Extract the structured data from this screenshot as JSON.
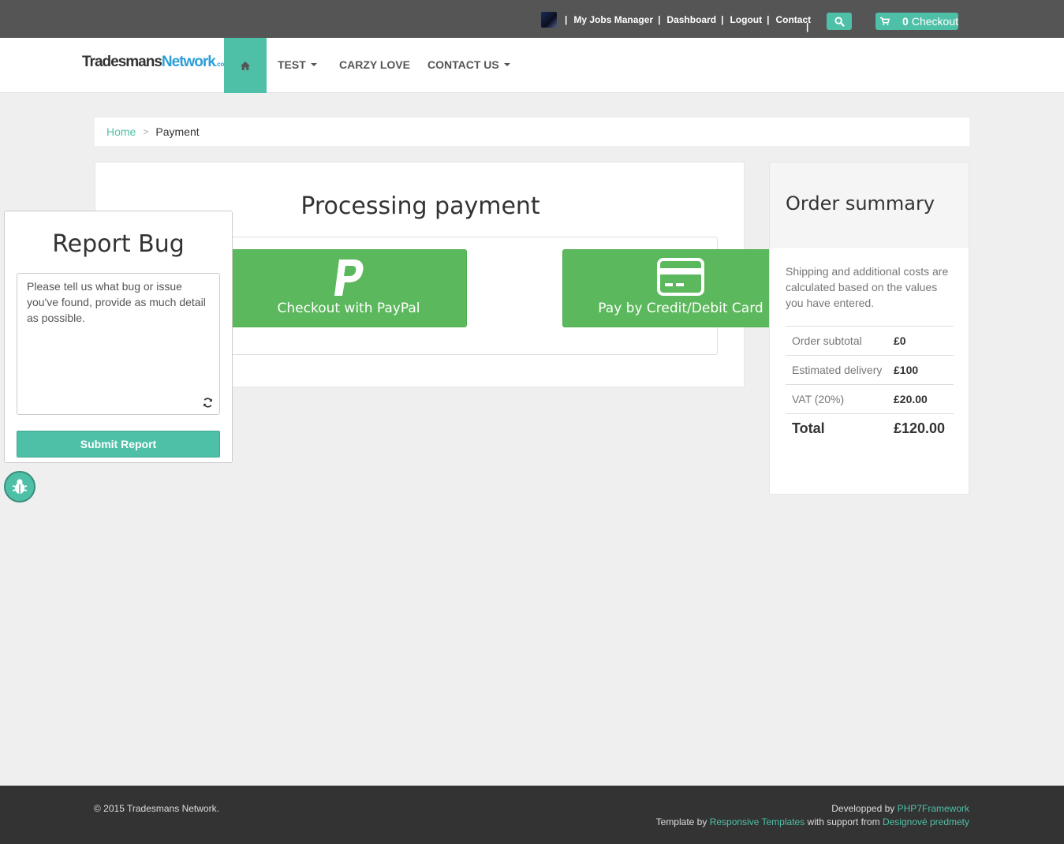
{
  "topbar": {
    "links": [
      "My Jobs Manager",
      "Dashboard",
      "Logout",
      "Contact"
    ],
    "separator": "|",
    "checkout_count": "0",
    "checkout_label": "Checkout",
    "icons": {
      "search": "search-icon",
      "cart": "cart-icon"
    }
  },
  "navbar": {
    "logo_part1": "Tradesmans",
    "logo_part2": "Network",
    "logo_part3": ".com",
    "items": [
      {
        "label": "TEST",
        "dropdown": true
      },
      {
        "label": "CARZY LOVE",
        "dropdown": false
      },
      {
        "label": "CONTACT US",
        "dropdown": true
      }
    ]
  },
  "breadcrumb": {
    "home": "Home",
    "divider": ">",
    "current": "Payment"
  },
  "main": {
    "title": "Processing payment",
    "paypal_label": "Checkout with PayPal",
    "card_label": "Pay by Credit/Debit Card"
  },
  "summary": {
    "title": "Order summary",
    "note": "Shipping and additional costs are calculated based on the values you have entered.",
    "rows": [
      {
        "label": "Order subtotal",
        "value": "£0"
      },
      {
        "label": "Estimated delivery",
        "value": "£100"
      },
      {
        "label": "VAT (20%)",
        "value": "£20.00"
      }
    ],
    "total_label": "Total",
    "total_value": "£120.00"
  },
  "bug_report": {
    "title": "Report Bug",
    "placeholder": "Please tell us what bug or issue you've found, provide as much detail as possible.",
    "submit_label": "Submit Report"
  },
  "footer": {
    "copyright": "© 2015 Tradesmans Network.",
    "developed_by": "Developped by",
    "developer_link": "PHP7Framework",
    "template_by": "Template by",
    "template_link": "Responsive Templates",
    "support_text": "with support from",
    "support_link": "Designové predmety"
  },
  "colors": {
    "accent": "#4fc0a8",
    "pay_button": "#5cb85c",
    "topbar": "#555555",
    "footer": "#333333"
  }
}
